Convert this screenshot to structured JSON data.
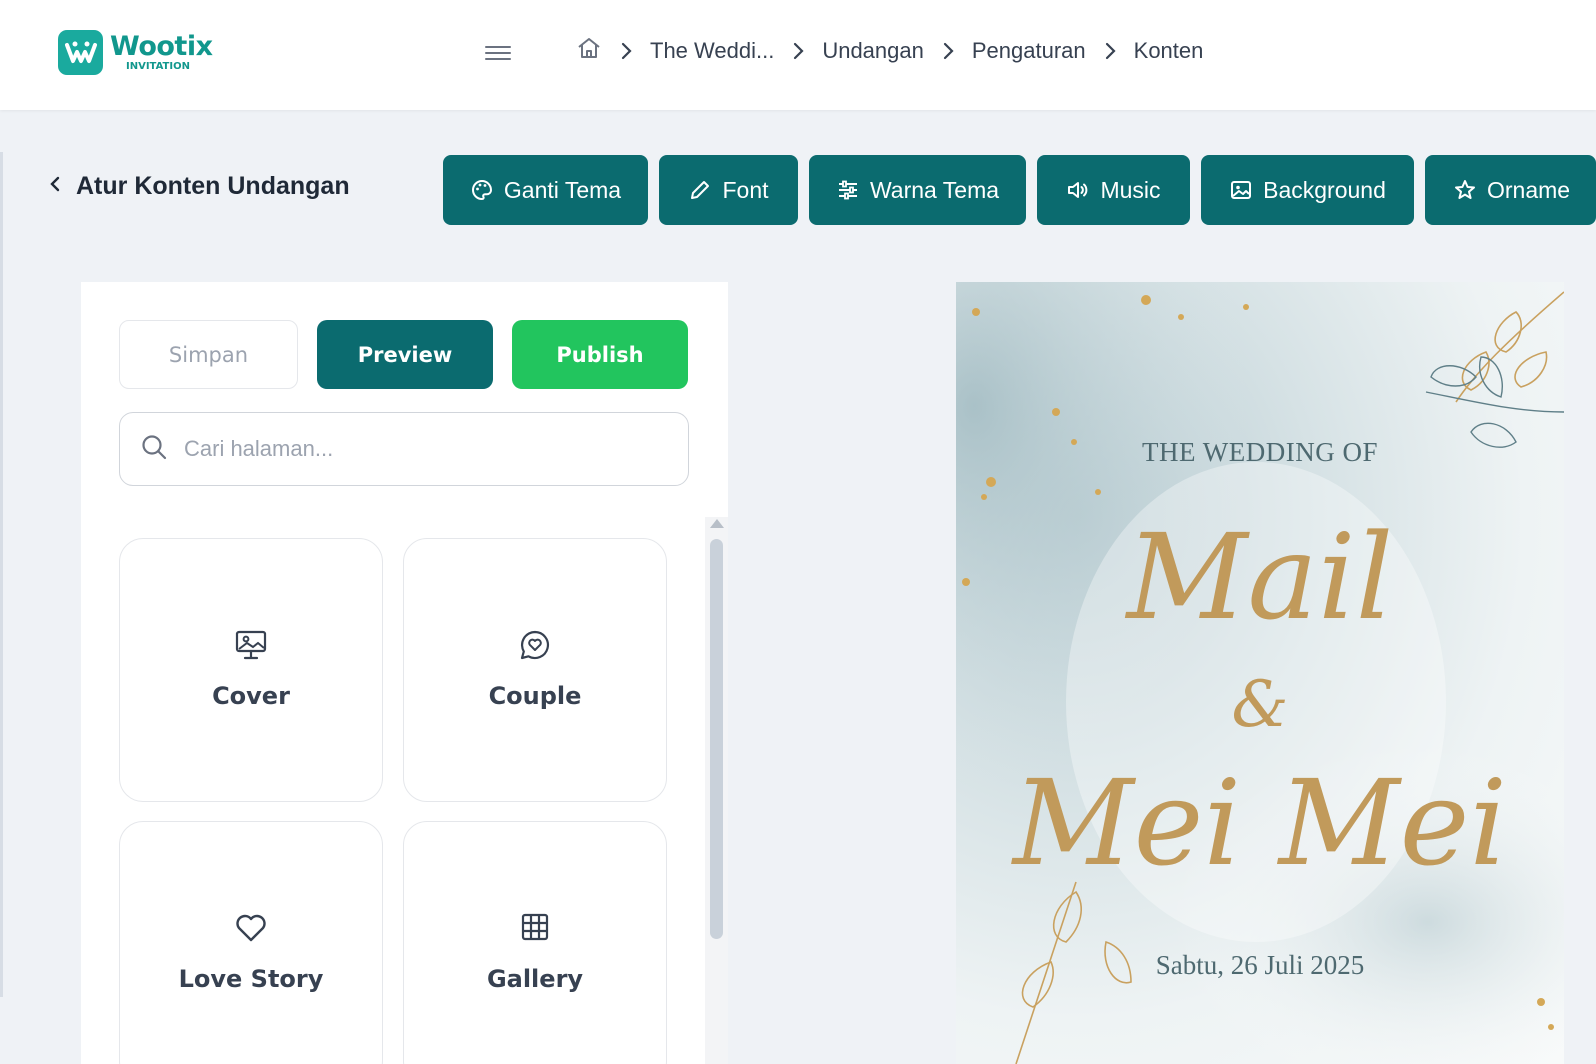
{
  "app": {
    "brand_name": "Wootix",
    "brand_sub": "INVITATION"
  },
  "breadcrumb": {
    "home_icon": "home-icon",
    "items": [
      "The Weddi...",
      "Undangan",
      "Pengaturan",
      "Konten"
    ]
  },
  "page": {
    "back_label": "Atur Konten Undangan"
  },
  "toolbar": {
    "buttons": [
      {
        "label": "Ganti Tema",
        "icon": "palette-icon"
      },
      {
        "label": "Font",
        "icon": "pencil-icon"
      },
      {
        "label": "Warna Tema",
        "icon": "sliders-icon"
      },
      {
        "label": "Music",
        "icon": "speaker-icon"
      },
      {
        "label": "Background",
        "icon": "image-icon"
      },
      {
        "label": "Orname",
        "icon": "star-icon"
      }
    ]
  },
  "actions": {
    "save_label": "Simpan",
    "preview_label": "Preview",
    "publish_label": "Publish"
  },
  "search": {
    "placeholder": "Cari halaman...",
    "value": ""
  },
  "sections": [
    {
      "label": "Cover",
      "icon": "cover-image-icon"
    },
    {
      "label": "Couple",
      "icon": "chat-heart-icon"
    },
    {
      "label": "Love Story",
      "icon": "heart-icon"
    },
    {
      "label": "Gallery",
      "icon": "grid-icon"
    }
  ],
  "invitation_preview": {
    "heading": "THE WEDDING OF",
    "name_1": "Mail",
    "ampersand": "&",
    "name_2": "Mei Mei",
    "date": "Sabtu, 26 Juli 2025"
  },
  "colors": {
    "primary": "#0b6b6f",
    "publish": "#22c55e",
    "brand": "#1aaa9e",
    "gold": "#c19a5b"
  }
}
